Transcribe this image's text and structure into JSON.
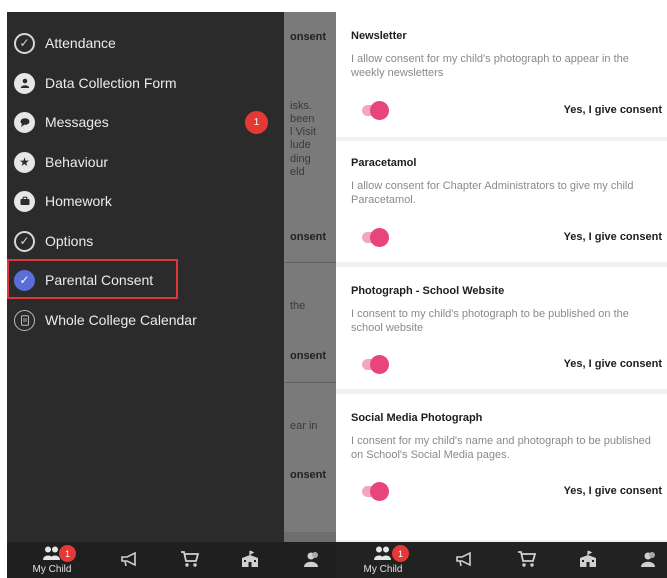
{
  "left_screen": {
    "background_fragments": [
      "onsent",
      "isks.",
      "been",
      "l Visit",
      "lude",
      "ding",
      "eld",
      "onsent",
      "the",
      "onsent",
      "ear in",
      "onsent"
    ],
    "drawer": {
      "items": [
        {
          "label": "Attendance",
          "icon": "check-circle-icon"
        },
        {
          "label": "Data Collection Form",
          "icon": "person-circle-icon"
        },
        {
          "label": "Messages",
          "icon": "chat-bubble-icon",
          "badge": "1"
        },
        {
          "label": "Behaviour",
          "icon": "star-hand-icon"
        },
        {
          "label": "Homework",
          "icon": "briefcase-icon"
        },
        {
          "label": "Options",
          "icon": "check-circle-icon"
        },
        {
          "label": "Parental Consent",
          "icon": "check-circle-icon",
          "active": true
        },
        {
          "label": "Whole College Calendar",
          "icon": "document-icon"
        }
      ]
    },
    "bottom_nav": {
      "my_child_label": "My Child",
      "badge": "1"
    }
  },
  "right_screen": {
    "consents": [
      {
        "title": "Newsletter",
        "description": "I allow consent for my child's photograph to appear in the weekly newsletters",
        "answer": "Yes, I give consent"
      },
      {
        "title": "Paracetamol",
        "description": "I allow consent for Chapter Administrators to give my child Paracetamol.",
        "answer": "Yes, I give consent"
      },
      {
        "title": "Photograph - School Website",
        "description": "I consent to my child's photograph to be published on the school website",
        "answer": "Yes, I give consent"
      },
      {
        "title": "Social Media Photograph",
        "description": "I consent for my child's name and photograph to be published on School's Social Media pages.",
        "answer": "Yes, I give consent"
      }
    ],
    "bottom_nav": {
      "my_child_label": "My Child",
      "badge": "1"
    }
  },
  "colors": {
    "accent_pink": "#e8447e",
    "badge_red": "#e53935",
    "active_blue": "#5a6fd6",
    "highlight_red": "#e0373a"
  }
}
